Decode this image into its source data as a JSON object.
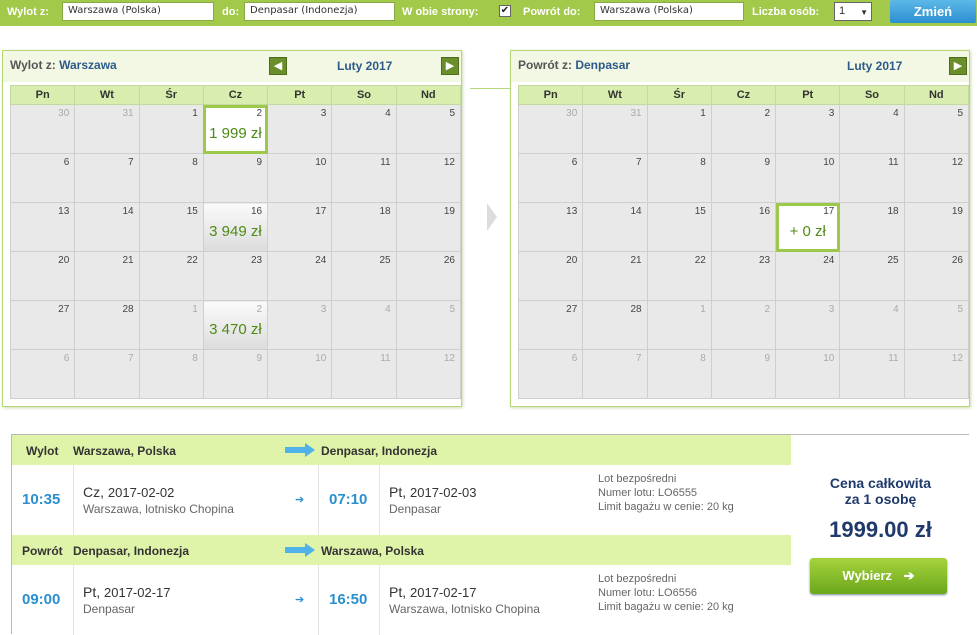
{
  "search": {
    "from_label": "Wylot z:",
    "from_value": "Warszawa (Polska)",
    "to_label": "do:",
    "to_value": "Denpasar (Indonezja)",
    "round_trip_label": "W obie strony:",
    "round_trip_checked": "✔",
    "return_label": "Powrót do:",
    "return_value": "Warszawa (Polska)",
    "persons_label": "Liczba osób:",
    "persons_value": "1",
    "change_button": "Zmień"
  },
  "outbound_calendar": {
    "title_prefix": "Wylot z:",
    "title_city": "Warszawa",
    "month": "Luty 2017",
    "weekdays": [
      "Pn",
      "Wt",
      "Śr",
      "Cz",
      "Pt",
      "So",
      "Nd"
    ],
    "weeks": [
      [
        {
          "d": "30",
          "o": true
        },
        {
          "d": "31",
          "o": true
        },
        {
          "d": "1"
        },
        {
          "d": "2",
          "p": "1 999 zł",
          "sel": true
        },
        {
          "d": "3"
        },
        {
          "d": "4"
        },
        {
          "d": "5"
        }
      ],
      [
        {
          "d": "6"
        },
        {
          "d": "7"
        },
        {
          "d": "8"
        },
        {
          "d": "9"
        },
        {
          "d": "10"
        },
        {
          "d": "11"
        },
        {
          "d": "12"
        }
      ],
      [
        {
          "d": "13"
        },
        {
          "d": "14"
        },
        {
          "d": "15"
        },
        {
          "d": "16",
          "p": "3 949 zł"
        },
        {
          "d": "17"
        },
        {
          "d": "18"
        },
        {
          "d": "19"
        }
      ],
      [
        {
          "d": "20"
        },
        {
          "d": "21"
        },
        {
          "d": "22"
        },
        {
          "d": "23"
        },
        {
          "d": "24"
        },
        {
          "d": "25"
        },
        {
          "d": "26"
        }
      ],
      [
        {
          "d": "27"
        },
        {
          "d": "28"
        },
        {
          "d": "1",
          "o": true
        },
        {
          "d": "2",
          "o": true,
          "p": "3 470 zł"
        },
        {
          "d": "3",
          "o": true
        },
        {
          "d": "4",
          "o": true
        },
        {
          "d": "5",
          "o": true
        }
      ],
      [
        {
          "d": "6",
          "o": true
        },
        {
          "d": "7",
          "o": true
        },
        {
          "d": "8",
          "o": true
        },
        {
          "d": "9",
          "o": true
        },
        {
          "d": "10",
          "o": true
        },
        {
          "d": "11",
          "o": true
        },
        {
          "d": "12",
          "o": true
        }
      ]
    ]
  },
  "return_calendar": {
    "title_prefix": "Powrót z:",
    "title_city": "Denpasar",
    "month": "Luty 2017",
    "weekdays": [
      "Pn",
      "Wt",
      "Śr",
      "Cz",
      "Pt",
      "So",
      "Nd"
    ],
    "weeks": [
      [
        {
          "d": "30",
          "o": true
        },
        {
          "d": "31",
          "o": true
        },
        {
          "d": "1"
        },
        {
          "d": "2"
        },
        {
          "d": "3"
        },
        {
          "d": "4"
        },
        {
          "d": "5"
        }
      ],
      [
        {
          "d": "6"
        },
        {
          "d": "7"
        },
        {
          "d": "8"
        },
        {
          "d": "9"
        },
        {
          "d": "10"
        },
        {
          "d": "11"
        },
        {
          "d": "12"
        }
      ],
      [
        {
          "d": "13"
        },
        {
          "d": "14"
        },
        {
          "d": "15"
        },
        {
          "d": "16"
        },
        {
          "d": "17",
          "p": "+ 0 zł",
          "sel": true
        },
        {
          "d": "18"
        },
        {
          "d": "19"
        }
      ],
      [
        {
          "d": "20"
        },
        {
          "d": "21"
        },
        {
          "d": "22"
        },
        {
          "d": "23"
        },
        {
          "d": "24"
        },
        {
          "d": "25"
        },
        {
          "d": "26"
        }
      ],
      [
        {
          "d": "27"
        },
        {
          "d": "28"
        },
        {
          "d": "1",
          "o": true
        },
        {
          "d": "2",
          "o": true
        },
        {
          "d": "3",
          "o": true
        },
        {
          "d": "4",
          "o": true
        },
        {
          "d": "5",
          "o": true
        }
      ],
      [
        {
          "d": "6",
          "o": true
        },
        {
          "d": "7",
          "o": true
        },
        {
          "d": "8",
          "o": true
        },
        {
          "d": "9",
          "o": true
        },
        {
          "d": "10",
          "o": true
        },
        {
          "d": "11",
          "o": true
        },
        {
          "d": "12",
          "o": true
        }
      ]
    ]
  },
  "outbound_flight": {
    "label": "Wylot",
    "from_city": "Warszawa, Polska",
    "to_city": "Denpasar, Indonezja",
    "dep_time": "10:35",
    "dep_day": "Cz,",
    "dep_date": "2017-02-02",
    "dep_airport": "Warszawa, lotnisko Chopina",
    "arr_time": "07:10",
    "arr_day": "Pt,",
    "arr_date": "2017-02-03",
    "arr_airport": "Denpasar",
    "info_direct": "Lot bezpośredni",
    "info_flight": "Numer lotu: LO6555",
    "info_baggage": "Limit bagażu w cenie: 20 kg"
  },
  "return_flight": {
    "label": "Powrót",
    "from_city": "Denpasar, Indonezja",
    "to_city": "Warszawa, Polska",
    "dep_time": "09:00",
    "dep_day": "Pt,",
    "dep_date": "2017-02-17",
    "dep_airport": "Denpasar",
    "arr_time": "16:50",
    "arr_day": "Pt,",
    "arr_date": "2017-02-17",
    "arr_airport": "Warszawa, lotnisko Chopina",
    "info_direct": "Lot bezpośredni",
    "info_flight": "Numer lotu: LO6556",
    "info_baggage": "Limit bagażu w cenie: 20 kg"
  },
  "price": {
    "line1": "Cena całkowita",
    "line2": "za 1 osobę",
    "total": "1999.00 zł",
    "select_button": "Wybierz",
    "select_arrow": "➔"
  },
  "icons": {
    "prev_month": "◀",
    "next_month": "▶",
    "small_arrow": "➔"
  },
  "colors": {
    "accent_green": "#a3c94a",
    "header_blue": "#2a8fcf",
    "price_green": "#4e8a14",
    "title_navy": "#1f3a6b"
  }
}
